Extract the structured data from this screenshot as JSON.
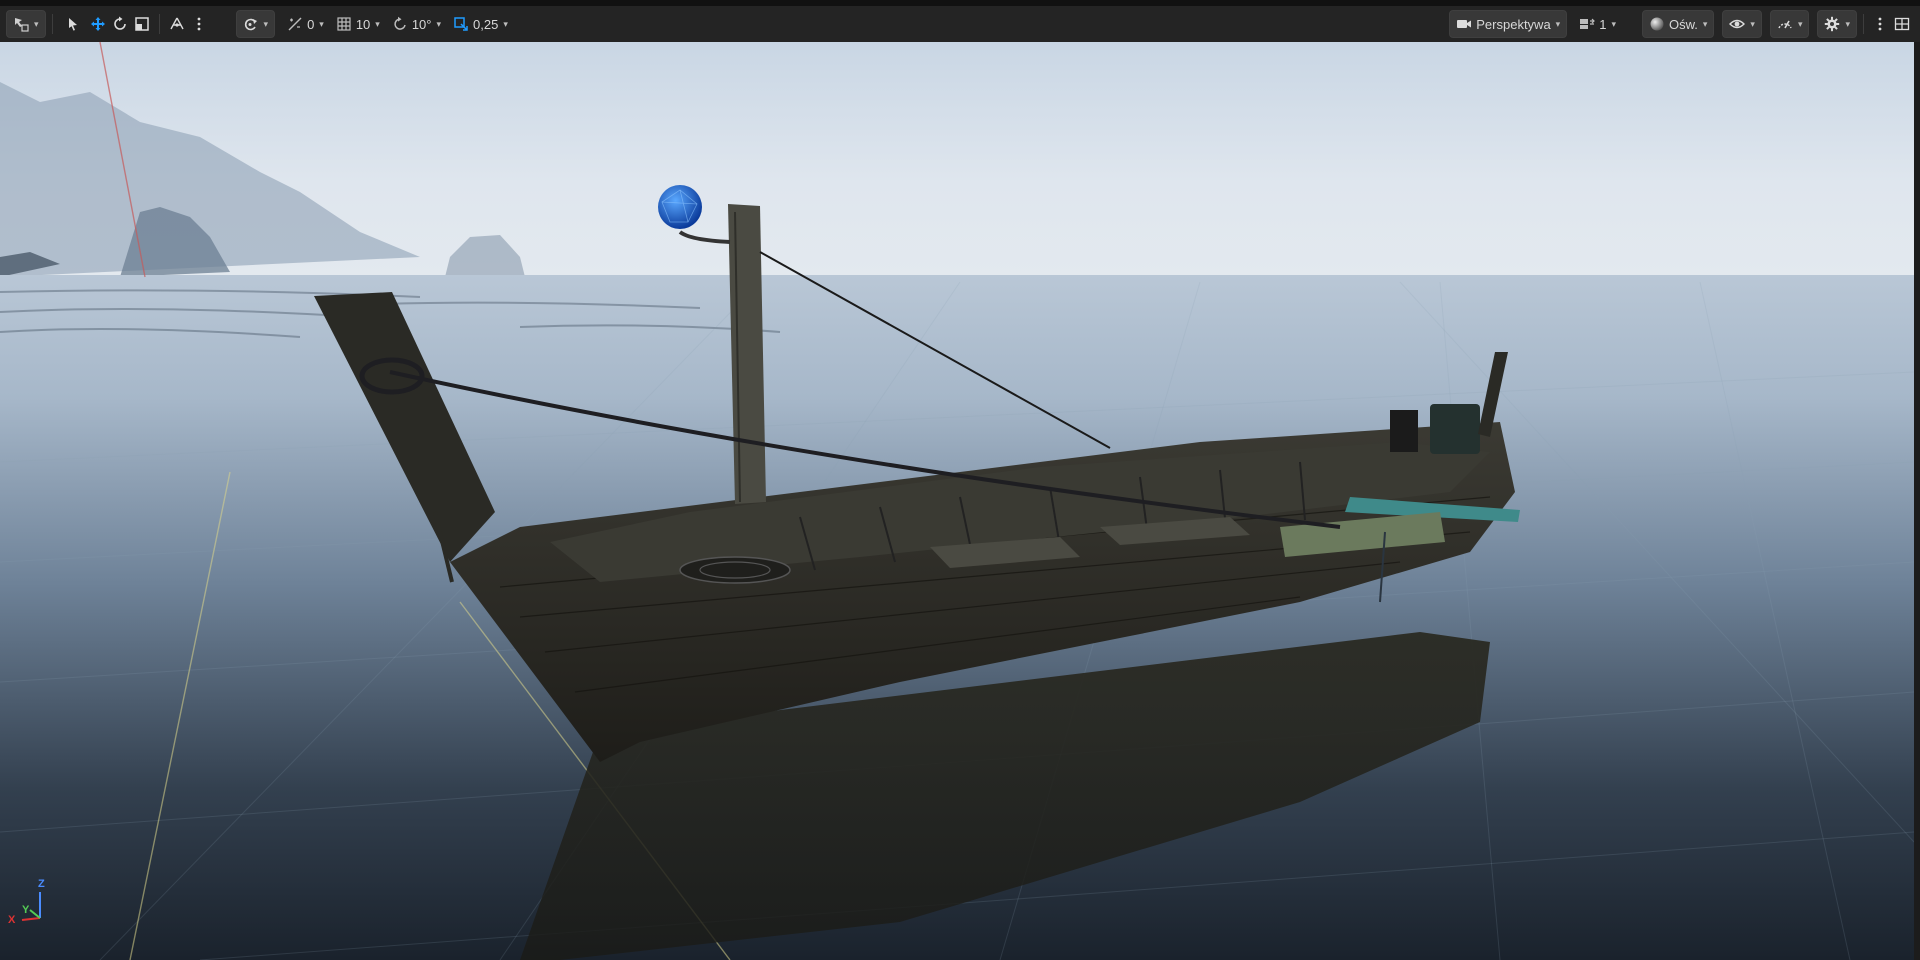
{
  "toolbar": {
    "left": {
      "select_mode": {
        "icon": "select-mode-icon"
      },
      "tools": [
        {
          "name": "select-tool-icon"
        },
        {
          "name": "translate-tool-icon",
          "active": true
        },
        {
          "name": "rotate-tool-icon"
        },
        {
          "name": "scale-tool-icon"
        }
      ],
      "coord_system": {
        "icon": "world-coordinate-icon"
      },
      "surface_snap": {
        "icon": "surface-snap-icon",
        "value": "0"
      },
      "grid_snap": {
        "icon": "grid-snap-icon",
        "value": "10"
      },
      "rotation_snap": {
        "icon": "rotation-snap-icon",
        "value": "10°"
      },
      "scale_snap": {
        "icon": "scale-snap-icon",
        "value": "0,25"
      },
      "camera_speed": {
        "icon": "camera-speed-icon"
      }
    },
    "right": {
      "view_mode": {
        "icon": "camera-icon",
        "label": "Perspektywa"
      },
      "layout": {
        "icon": "layout-icon",
        "value": "1"
      },
      "lighting": {
        "icon": "lit-sphere-icon",
        "label": "Ośw."
      },
      "show": {
        "icon": "eye-icon"
      },
      "performance": {
        "icon": "gauge-icon"
      },
      "settings": {
        "icon": "gear-icon"
      },
      "more": {
        "icon": "more-vertical-icon"
      },
      "maximize": {
        "icon": "grid-layout-icon"
      }
    }
  },
  "gizmo": {
    "z": "Z",
    "y": "Y",
    "x": "X"
  },
  "colors": {
    "toolbar_bg": "#242424",
    "accent_blue": "#1f9bff",
    "axis_x": "#d33",
    "axis_y": "#5c5",
    "axis_z": "#4a8cff"
  }
}
